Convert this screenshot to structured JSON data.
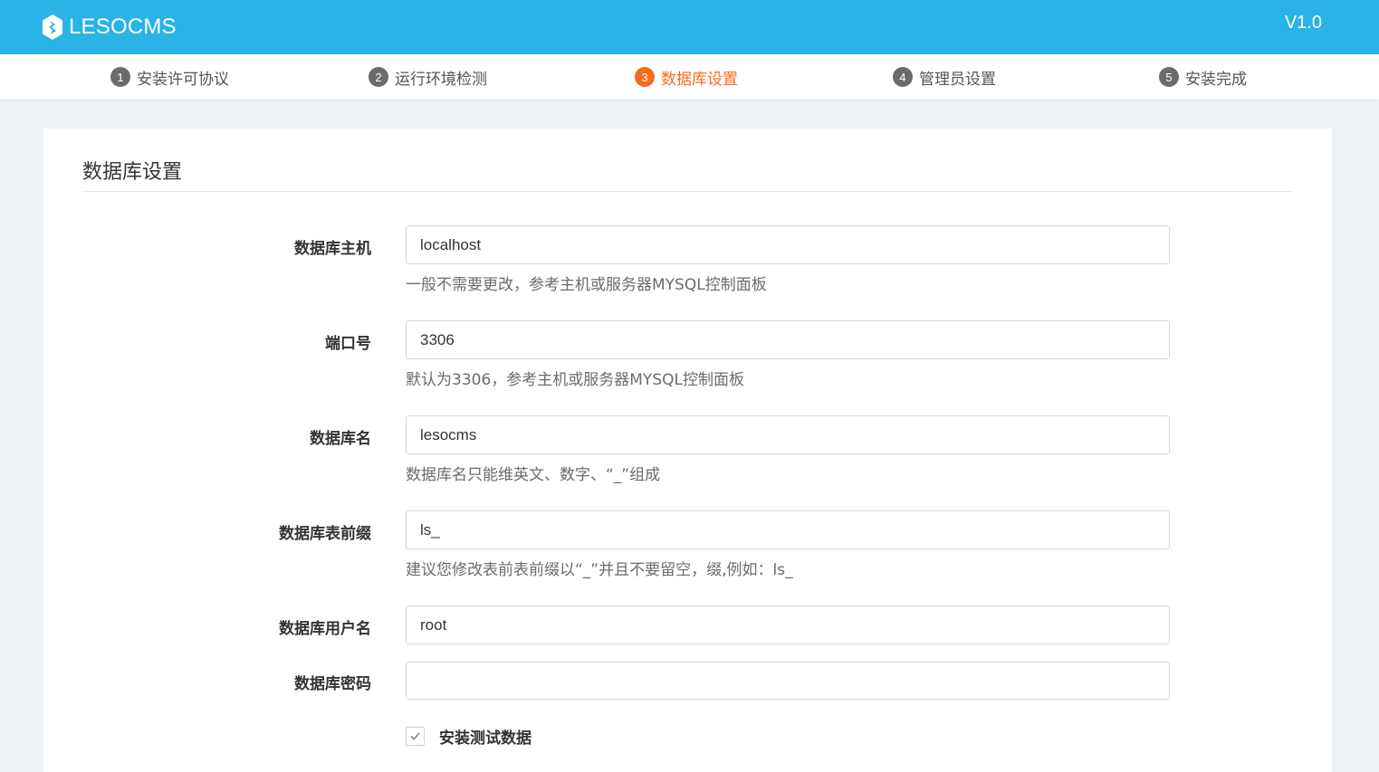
{
  "header": {
    "brand": "LESOCMS",
    "brand_icon": "leso-logo-icon",
    "version": "V1.0",
    "bar_color": "#29b3e6"
  },
  "steps": [
    {
      "num": "1",
      "label": "安装许可协议",
      "active": false
    },
    {
      "num": "2",
      "label": "运行环境检测",
      "active": false
    },
    {
      "num": "3",
      "label": "数据库设置",
      "active": true
    },
    {
      "num": "4",
      "label": "管理员设置",
      "active": false
    },
    {
      "num": "5",
      "label": "安装完成",
      "active": false
    }
  ],
  "accent_color": "#f56c1d",
  "panel": {
    "title": "数据库设置",
    "fields": [
      {
        "label": "数据库主机",
        "value": "localhost",
        "hint": "一般不需要更改，参考主机或服务器MYSQL控制面板"
      },
      {
        "label": "端口号",
        "value": "3306",
        "hint": "默认为3306，参考主机或服务器MYSQL控制面板"
      },
      {
        "label": "数据库名",
        "value": "lesocms",
        "hint": "数据库名只能维英文、数字、“_”组成"
      },
      {
        "label": "数据库表前缀",
        "value": "ls_",
        "hint": "建议您修改表前表前缀以“_”并且不要留空，缀,例如：ls_"
      },
      {
        "label": "数据库用户名",
        "value": "root",
        "hint": ""
      },
      {
        "label": "数据库密码",
        "value": "",
        "hint": ""
      }
    ],
    "checkbox": {
      "label": "安装测试数据",
      "checked": true
    }
  }
}
